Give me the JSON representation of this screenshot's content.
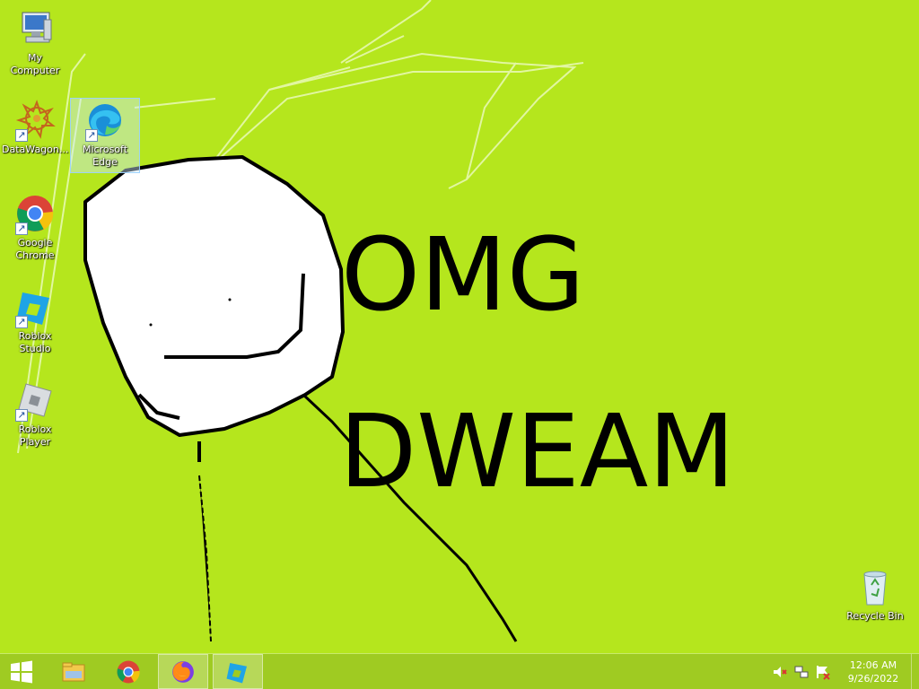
{
  "wallpaper": {
    "background": "#b5e61d",
    "text_line1": "OMG",
    "text_line2": "DWEAM"
  },
  "desktop_icons": [
    {
      "label": "My Computer",
      "icon": "my-computer-icon"
    },
    {
      "label": "DataWagon...",
      "icon": "datawagon-icon"
    },
    {
      "label": "Microsoft Edge",
      "icon": "edge-icon"
    },
    {
      "label": "Google Chrome",
      "icon": "chrome-icon"
    },
    {
      "label": "Roblox Studio",
      "icon": "roblox-studio-icon"
    },
    {
      "label": "Roblox Player",
      "icon": "roblox-player-icon"
    },
    {
      "label": "Recycle Bin",
      "icon": "recycle-bin-icon"
    }
  ],
  "taskbar": {
    "buttons": [
      "start-button",
      "file-explorer",
      "google-chrome",
      "firefox",
      "roblox-studio"
    ],
    "active": [
      "firefox",
      "roblox-studio"
    ],
    "clock": {
      "time": "12:06 AM",
      "date": "9/26/2022"
    },
    "tray": [
      "volume-muted-icon",
      "network-icon",
      "action-center-icon"
    ]
  }
}
